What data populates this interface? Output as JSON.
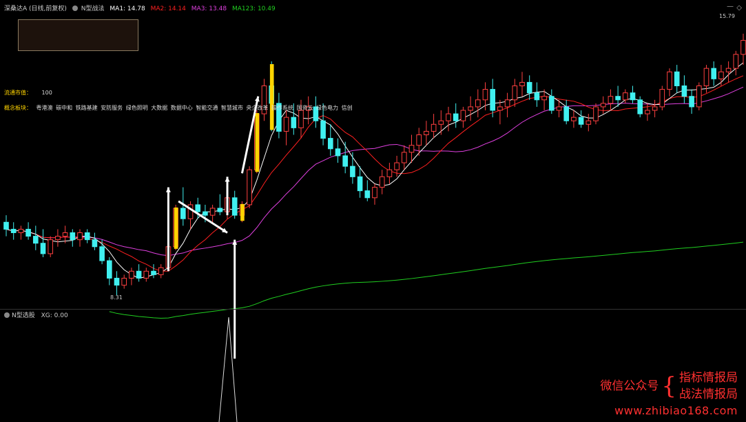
{
  "header": {
    "security": "深桑达A (日线,前复权)",
    "indicator": "N型战法",
    "ma1": {
      "label": "MA1: 14.78",
      "color": "#ffffff"
    },
    "ma2": {
      "label": "MA2: 14.14",
      "color": "#ff2020"
    },
    "ma3": {
      "label": "MA3: 13.48",
      "color": "#e040e0"
    },
    "ma123": {
      "label": "MA123: 10.49",
      "color": "#20d020"
    }
  },
  "info": {
    "market_cap_label": "流通市值：",
    "market_cap_value": "100",
    "concept_label": "概念板块：",
    "concepts": "粤港澳  碳中和  铁路基建  安防服务  绿色照明  大数据  数据中心  智能交通  智慧城市  央企改革  操作系统  国资云  绿色电力  信创"
  },
  "sub_panel": {
    "title": "N型选股",
    "xg": "XG: 0.00"
  },
  "watermark": {
    "left": "微信公众号",
    "right_top": "指标情报局",
    "right_bottom": "战法情报局",
    "url": "www.zhibiao168.com"
  },
  "chart_data": {
    "type": "candlestick",
    "low_label": "8.31",
    "high_label": "15.79",
    "ylim": [
      8.0,
      16.4
    ],
    "colors": {
      "up": "#ff4040",
      "down": "#40f0f0",
      "signal": "#ffd400",
      "ma1": "#ffffff",
      "ma2": "#ff2020",
      "ma3": "#e040e0",
      "ma123": "#20d020"
    },
    "candles": [
      [
        10.4,
        10.6,
        10.0,
        10.2
      ],
      [
        10.2,
        10.4,
        9.9,
        10.1
      ],
      [
        10.1,
        10.3,
        9.9,
        10.2
      ],
      [
        10.2,
        10.4,
        9.9,
        10.0
      ],
      [
        10.0,
        10.3,
        9.6,
        9.8
      ],
      [
        9.8,
        10.2,
        9.4,
        9.5
      ],
      [
        9.5,
        10.0,
        9.4,
        9.9
      ],
      [
        9.9,
        10.2,
        9.7,
        10.0
      ],
      [
        10.0,
        10.3,
        9.8,
        10.1
      ],
      [
        10.1,
        10.2,
        9.7,
        9.9
      ],
      [
        9.9,
        10.2,
        9.7,
        10.1
      ],
      [
        10.1,
        10.2,
        9.8,
        9.9
      ],
      [
        9.9,
        10.1,
        9.6,
        9.7
      ],
      [
        9.7,
        9.9,
        9.2,
        9.3
      ],
      [
        9.3,
        9.4,
        8.6,
        8.8
      ],
      [
        8.8,
        9.0,
        8.31,
        8.6
      ],
      [
        8.6,
        8.9,
        8.5,
        8.8
      ],
      [
        8.8,
        9.1,
        8.6,
        9.0
      ],
      [
        9.0,
        9.2,
        8.7,
        8.8
      ],
      [
        8.8,
        9.1,
        8.7,
        9.0
      ],
      [
        9.0,
        9.2,
        8.8,
        8.9
      ],
      [
        8.9,
        9.2,
        8.8,
        9.1
      ],
      [
        9.1,
        9.8,
        9.0,
        9.7
      ],
      [
        9.7,
        10.9,
        9.6,
        10.8
      ],
      [
        10.8,
        11.4,
        10.3,
        10.5
      ],
      [
        10.5,
        11.0,
        10.2,
        10.9
      ],
      [
        10.9,
        11.1,
        10.5,
        10.7
      ],
      [
        10.7,
        10.9,
        10.4,
        10.6
      ],
      [
        10.6,
        10.9,
        10.4,
        10.8
      ],
      [
        10.8,
        11.2,
        10.6,
        10.7
      ],
      [
        10.7,
        11.3,
        10.5,
        11.1
      ],
      [
        11.1,
        11.3,
        10.5,
        10.6
      ],
      [
        10.6,
        11.0,
        10.4,
        10.9
      ],
      [
        10.9,
        12.0,
        10.8,
        11.9
      ],
      [
        11.9,
        13.6,
        11.8,
        13.5
      ],
      [
        13.5,
        14.5,
        13.3,
        14.3
      ],
      [
        14.3,
        15.0,
        13.0,
        13.8
      ],
      [
        13.8,
        14.1,
        12.8,
        13.0
      ],
      [
        13.0,
        13.6,
        12.6,
        13.4
      ],
      [
        13.4,
        13.8,
        12.9,
        13.1
      ],
      [
        13.1,
        13.9,
        12.8,
        13.6
      ],
      [
        13.6,
        14.0,
        13.2,
        13.7
      ],
      [
        13.7,
        14.0,
        13.1,
        13.3
      ],
      [
        13.3,
        13.8,
        12.6,
        12.8
      ],
      [
        12.8,
        13.2,
        12.3,
        12.5
      ],
      [
        12.5,
        12.8,
        12.1,
        12.3
      ],
      [
        12.3,
        12.7,
        11.8,
        12.0
      ],
      [
        12.0,
        12.4,
        11.5,
        11.7
      ],
      [
        11.7,
        12.0,
        11.1,
        11.3
      ],
      [
        11.3,
        11.6,
        11.0,
        11.1
      ],
      [
        11.1,
        11.5,
        10.9,
        11.4
      ],
      [
        11.4,
        11.9,
        11.2,
        11.7
      ],
      [
        11.7,
        12.1,
        11.5,
        11.9
      ],
      [
        11.9,
        12.3,
        11.7,
        12.1
      ],
      [
        12.1,
        12.6,
        11.9,
        12.4
      ],
      [
        12.4,
        12.9,
        12.1,
        12.6
      ],
      [
        12.6,
        13.1,
        12.3,
        12.9
      ],
      [
        12.9,
        13.3,
        12.6,
        13.0
      ],
      [
        13.0,
        13.5,
        12.8,
        13.2
      ],
      [
        13.2,
        13.6,
        12.9,
        13.3
      ],
      [
        13.3,
        13.7,
        13.0,
        13.5
      ],
      [
        13.5,
        13.8,
        13.1,
        13.3
      ],
      [
        13.3,
        13.7,
        13.1,
        13.6
      ],
      [
        13.6,
        14.0,
        13.3,
        13.7
      ],
      [
        13.7,
        14.2,
        13.4,
        13.9
      ],
      [
        13.9,
        14.4,
        13.6,
        14.2
      ],
      [
        14.2,
        14.5,
        13.4,
        13.6
      ],
      [
        13.6,
        13.9,
        13.2,
        13.7
      ],
      [
        13.7,
        14.1,
        13.4,
        13.9
      ],
      [
        13.9,
        14.5,
        13.7,
        14.3
      ],
      [
        14.3,
        14.7,
        14.0,
        14.4
      ],
      [
        14.4,
        14.6,
        13.9,
        14.1
      ],
      [
        14.1,
        14.4,
        13.7,
        13.9
      ],
      [
        13.9,
        14.2,
        13.6,
        14.0
      ],
      [
        14.0,
        14.2,
        13.5,
        13.6
      ],
      [
        13.6,
        13.9,
        13.4,
        13.7
      ],
      [
        13.7,
        13.9,
        13.2,
        13.3
      ],
      [
        13.3,
        13.6,
        13.1,
        13.4
      ],
      [
        13.4,
        13.6,
        13.1,
        13.2
      ],
      [
        13.2,
        13.5,
        13.0,
        13.3
      ],
      [
        13.3,
        13.8,
        13.2,
        13.7
      ],
      [
        13.7,
        14.0,
        13.5,
        13.8
      ],
      [
        13.8,
        14.2,
        13.6,
        14.0
      ],
      [
        14.0,
        14.3,
        13.7,
        13.9
      ],
      [
        13.9,
        14.2,
        13.8,
        14.1
      ],
      [
        14.1,
        14.3,
        13.8,
        13.9
      ],
      [
        13.9,
        14.0,
        13.4,
        13.5
      ],
      [
        13.5,
        13.8,
        13.3,
        13.6
      ],
      [
        13.6,
        13.9,
        13.4,
        13.7
      ],
      [
        13.7,
        14.3,
        13.6,
        14.2
      ],
      [
        14.2,
        14.8,
        14.0,
        14.7
      ],
      [
        14.7,
        14.9,
        14.1,
        14.3
      ],
      [
        14.3,
        14.6,
        13.8,
        14.0
      ],
      [
        14.0,
        14.2,
        13.5,
        13.7
      ],
      [
        13.7,
        14.4,
        13.6,
        14.3
      ],
      [
        14.3,
        14.9,
        14.1,
        14.8
      ],
      [
        14.8,
        15.0,
        14.3,
        14.5
      ],
      [
        14.5,
        14.9,
        14.3,
        14.7
      ],
      [
        14.7,
        15.0,
        14.4,
        14.8
      ],
      [
        14.8,
        15.3,
        14.6,
        15.2
      ],
      [
        15.2,
        15.79,
        14.9,
        15.6
      ]
    ]
  }
}
